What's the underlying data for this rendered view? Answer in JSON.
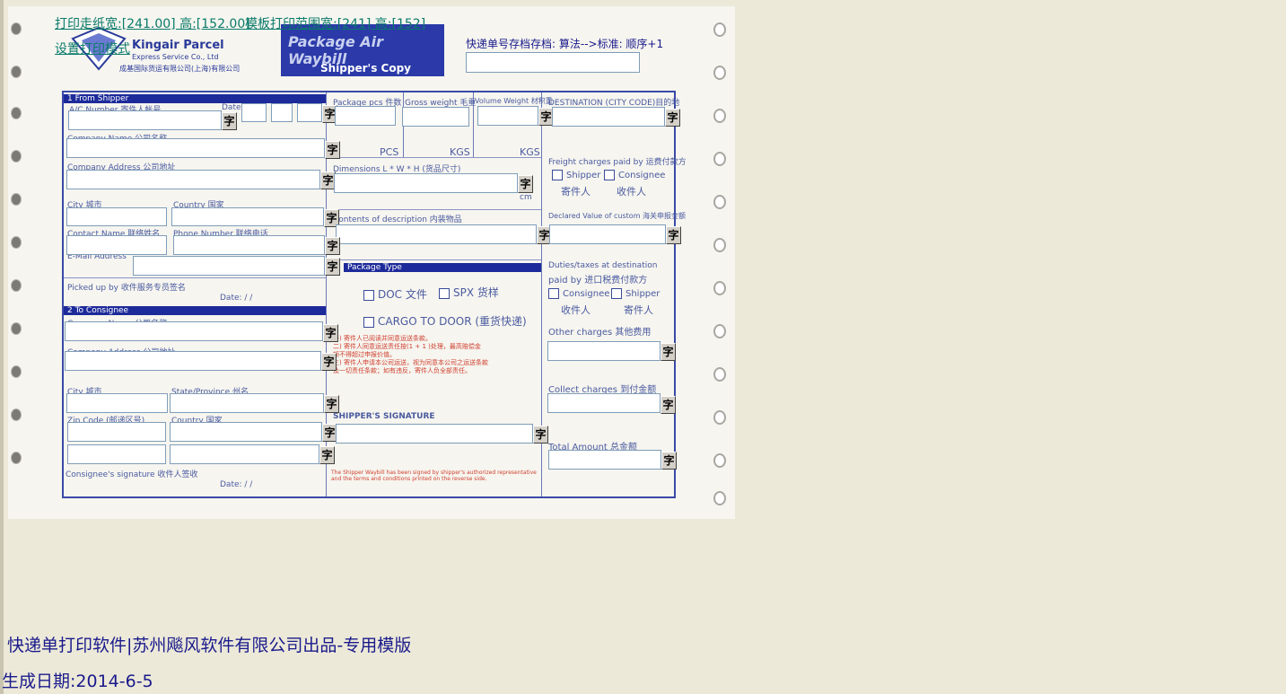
{
  "header": {
    "paper_size_link": "打印走纸宽:[241.00] 高:[152.00]",
    "template_range_link": "模板打印范围宽:[241] 高:[152]",
    "set_mode_link": "设置打印模式",
    "tracking_label": "快递单号存档存档: 算法-->标准: 顺序+1",
    "tracking_value": ""
  },
  "brand": {
    "company_en": "Kingair Parcel",
    "company_sub": "Express Service Co., Ltd",
    "company_cn": "成基国际货运有限公司(上海)有限公司",
    "waybill_title": "Package Air Waybill",
    "copy_title": "Shipper's Copy"
  },
  "form": {
    "section1": "1  From Shipper",
    "ac_number": "A/C Number  寄件人帐号",
    "date": "Date",
    "company_name": "Company Name  公司名称",
    "company_address": "Company Address  公司地址",
    "city": "City 城市",
    "country": "Country  国家",
    "contact_name": "Contact Name  联络姓名",
    "phone": "Phone Number 联络电话",
    "email": "E-Mail Address",
    "picked_up": "Picked up by  收件服务专员签名",
    "date2": "Date:     /     /",
    "section2": "2  To Consignee",
    "c_company_name": "Company Name  公司名称",
    "c_company_address": "Company Address  公司地址",
    "c_city": "City 城市",
    "state": "State/Province  州名",
    "zip": "Zip Code (邮递区号)",
    "c_country": "Country  国家",
    "consignee_sig": "Consignee's signature  收件人签收",
    "date3": "Date:     /     /",
    "pcs_head": "Package pcs 件数",
    "gross_head": "Gross weight 毛重",
    "volume_head": "Volume Weight 材积重",
    "pcs": "PCS",
    "kgs1": "KGS",
    "kgs2": "KGS",
    "dimensions": "Dimensions L * W * H  (货品尺寸)",
    "cm": "cm",
    "contents": "Contents of description 内装物品",
    "package_type": "Package Type",
    "doc": "DOC 文件",
    "spx": "SPX 货样",
    "cargo": "CARGO TO DOOR (重货快递)",
    "notes": [
      "一) 寄件人已阅读并同意运送条款。",
      "二) 寄件人同意运送责任按(1 + 1 )处理，最高赔偿金",
      "   额不得超过申报价值。",
      "三) 寄件人申请本公司运送，视为同意本公司之运送条款",
      "   及一切责任条款；如有违反，寄件人负全部责任。"
    ],
    "shipper_sig": "SHIPPER'S SIGNATURE",
    "disclaimer": "The Shipper Waybill has been signed by shipper's authorized representative and the terms and conditions printed on the reverse side.",
    "destination": "DESTINATION (CITY CODE)目的地",
    "freight_paid": "Freight charges paid by 运费付款方",
    "shipper": "Shipper",
    "shipper_cn": "寄件人",
    "consignee": "Consignee",
    "consignee_cn": "收件人",
    "declared_value": "Declared Value of custom  海关申报金额",
    "duties": "Duties/taxes at destination",
    "paid_by": "paid by  进口税费付款方",
    "consignee2": "Consignee",
    "consignee2_cn": "收件人",
    "shipper2": "Shipper",
    "shipper2_cn": "寄件人",
    "other_charges": "Other charges 其他费用",
    "collect_charges": "Collect charges 到付金额",
    "total_amount": "Total Amount  总金额"
  },
  "zi_label": "字",
  "footer": {
    "line1": "快递单打印软件|苏州飚风软件有限公司出品-专用模版",
    "line2": "生成日期:2014-6-5"
  }
}
